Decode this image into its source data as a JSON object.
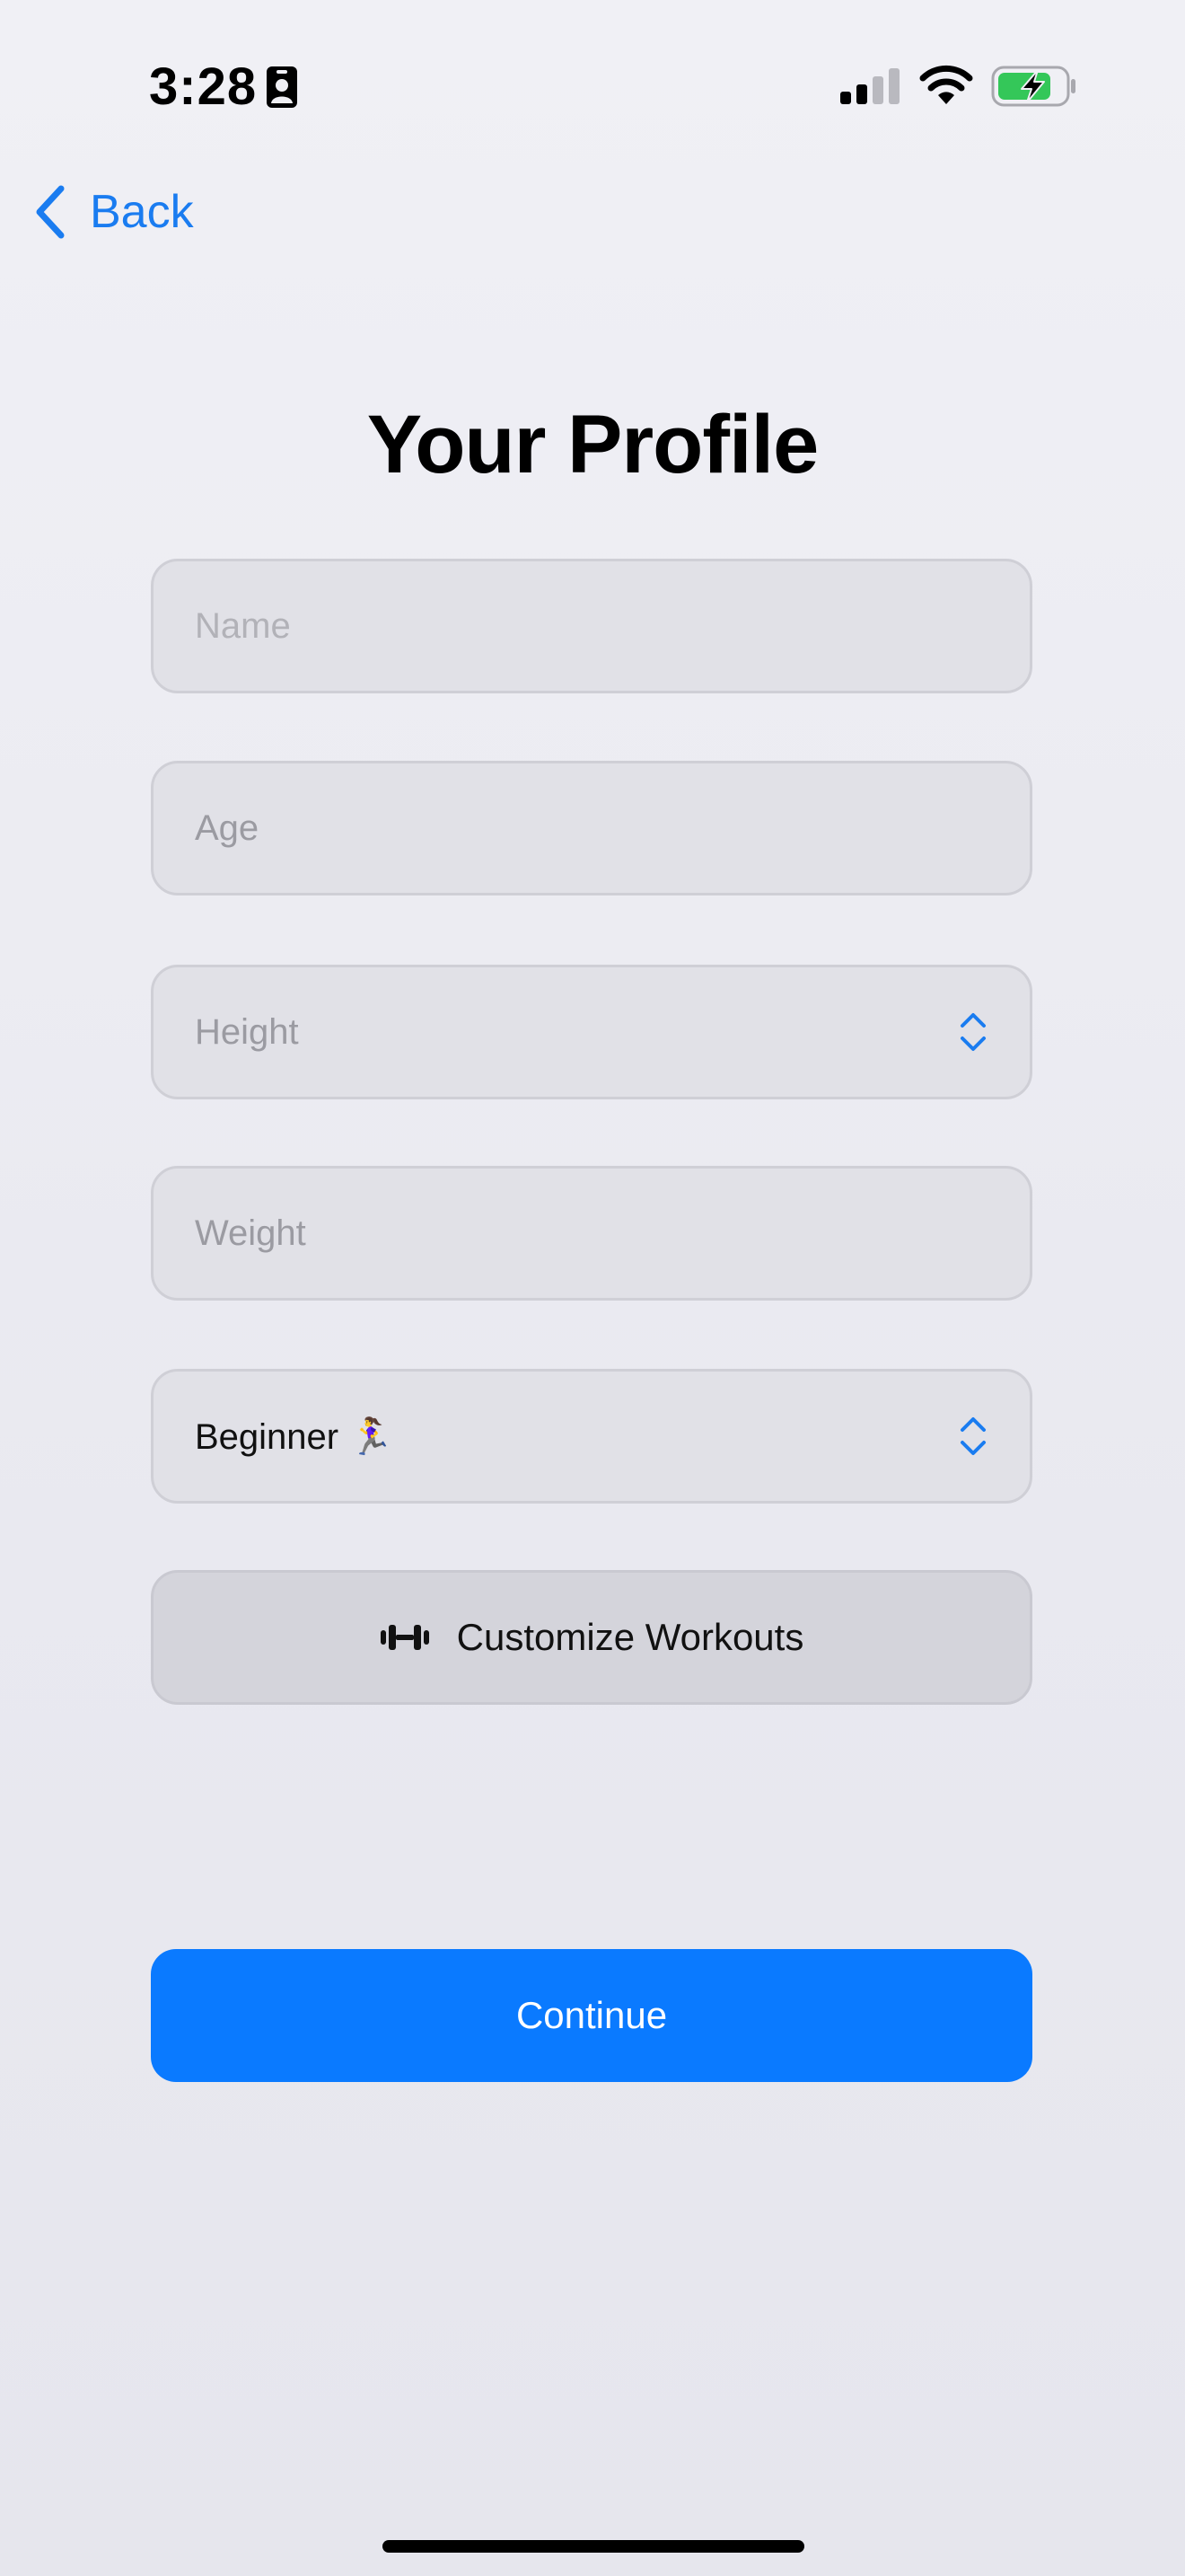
{
  "status_bar": {
    "time": "3:28",
    "icons": [
      "id-card-icon",
      "cellular-signal-icon",
      "wifi-icon",
      "battery-charging-icon"
    ]
  },
  "nav": {
    "back_label": "Back",
    "back_icon": "chevron-left-icon"
  },
  "page": {
    "title": "Your Profile"
  },
  "form": {
    "name": {
      "placeholder": "Name",
      "value": ""
    },
    "age": {
      "placeholder": "Age",
      "value": ""
    },
    "height": {
      "placeholder": "Height",
      "icon": "up-down-chevron-icon"
    },
    "weight": {
      "placeholder": "Weight",
      "value": ""
    },
    "level": {
      "value": "Beginner 🏃‍♀️",
      "icon": "up-down-chevron-icon"
    }
  },
  "actions": {
    "customize_label": "Customize Workouts",
    "customize_icon": "dumbbell-icon",
    "continue_label": "Continue"
  },
  "colors": {
    "accent": "#0A7AFF",
    "link": "#1A7CF0",
    "field_background": "#E1E1E7",
    "secondary_button_background": "#D4D4DB",
    "battery_charging": "#34C759"
  }
}
